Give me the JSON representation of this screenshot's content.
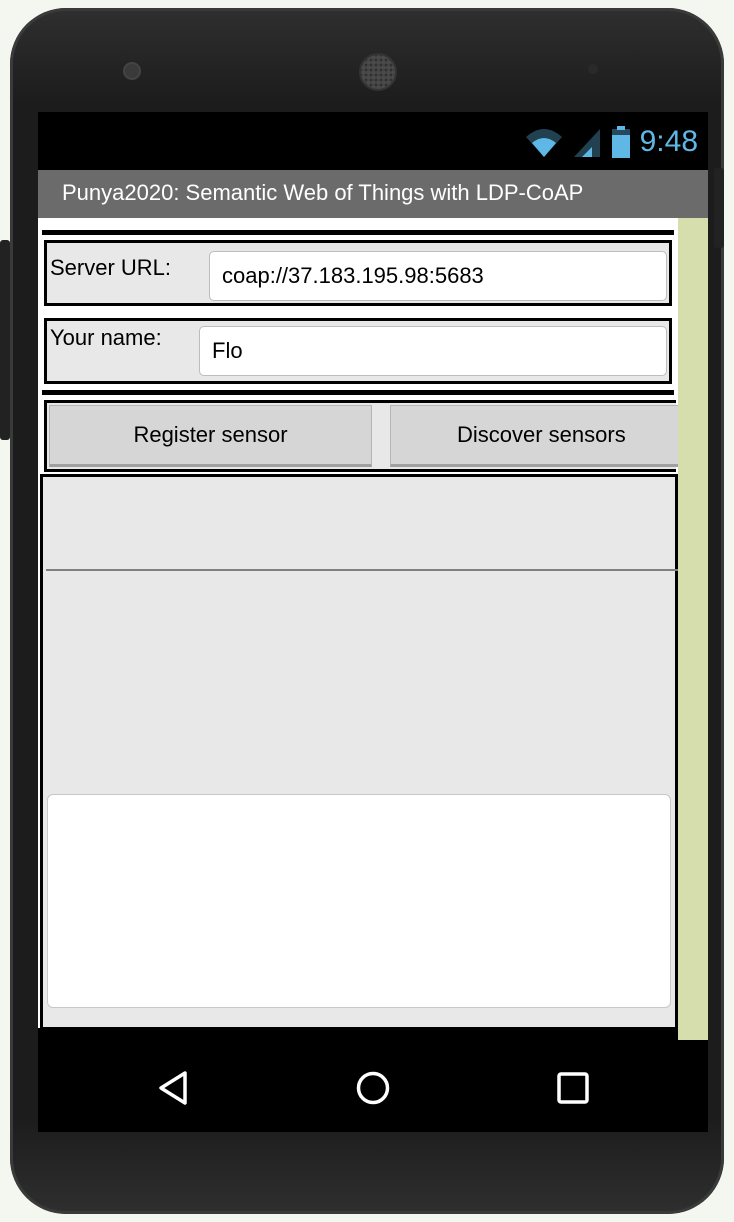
{
  "status_bar": {
    "time": "9:48",
    "icons": [
      "wifi-icon",
      "signal-icon",
      "battery-icon"
    ]
  },
  "app": {
    "title": "Punya2020: Semantic Web of Things with LDP-CoAP"
  },
  "form": {
    "server_url_label": "Server URL:",
    "server_url_value": "coap://37.183.195.98:5683",
    "name_label": "Your name:",
    "name_value": "Flo"
  },
  "buttons": {
    "register": "Register sensor",
    "discover": "Discover sensors"
  },
  "output": {
    "text": ""
  },
  "nav": {
    "icons": [
      "back-icon",
      "home-icon",
      "recents-icon"
    ]
  },
  "colors": {
    "title_bar": "#6b6b6b",
    "clock": "#5fb7e5",
    "scroll_strip": "#d5deac",
    "block_bg": "#e8e8e8"
  }
}
